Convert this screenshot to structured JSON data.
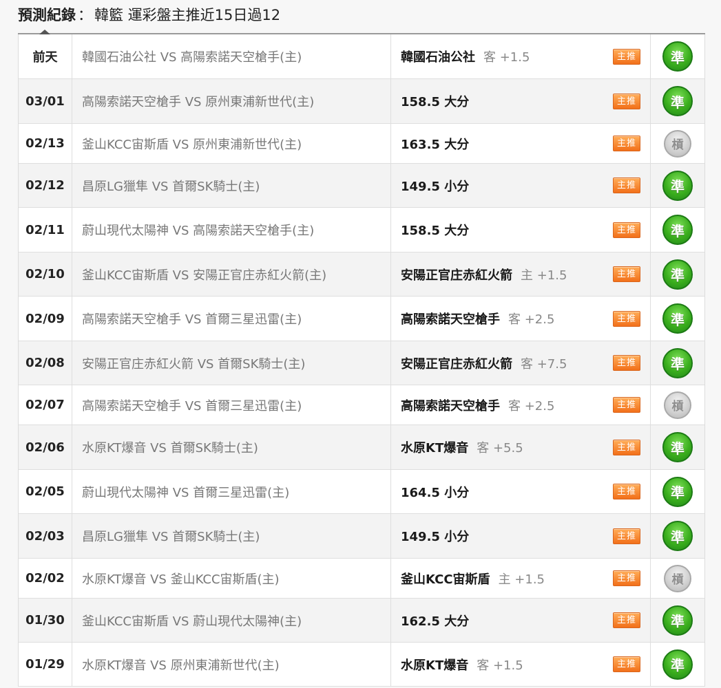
{
  "header": {
    "label": "預測紀錄",
    "separator": "：",
    "summary": "韓籃 運彩盤主推近15日過12"
  },
  "badge_label": "主推",
  "rows": [
    {
      "date": "前天",
      "match": "韓國石油公社 VS 高陽索諾天空槍手(主)",
      "pick": "韓國石油公社",
      "spread": "客 +1.5",
      "result": "準",
      "hit": true
    },
    {
      "date": "03/01",
      "match": "高陽索諾天空槍手 VS 原州東浦新世代(主)",
      "pick": "158.5 大分",
      "spread": "",
      "result": "準",
      "hit": true
    },
    {
      "date": "02/13",
      "match": "釜山KCC宙斯盾 VS 原州東浦新世代(主)",
      "pick": "163.5 大分",
      "spread": "",
      "result": "槓",
      "hit": false
    },
    {
      "date": "02/12",
      "match": "昌原LG獵隼 VS 首爾SK騎士(主)",
      "pick": "149.5 小分",
      "spread": "",
      "result": "準",
      "hit": true
    },
    {
      "date": "02/11",
      "match": "蔚山現代太陽神 VS 高陽索諾天空槍手(主)",
      "pick": "158.5 大分",
      "spread": "",
      "result": "準",
      "hit": true
    },
    {
      "date": "02/10",
      "match": "釜山KCC宙斯盾 VS 安陽正官庄赤紅火箭(主)",
      "pick": "安陽正官庄赤紅火箭",
      "spread": "主 +1.5",
      "result": "準",
      "hit": true
    },
    {
      "date": "02/09",
      "match": "高陽索諾天空槍手 VS 首爾三星迅雷(主)",
      "pick": "高陽索諾天空槍手",
      "spread": "客 +2.5",
      "result": "準",
      "hit": true
    },
    {
      "date": "02/08",
      "match": "安陽正官庄赤紅火箭 VS 首爾SK騎士(主)",
      "pick": "安陽正官庄赤紅火箭",
      "spread": "客 +7.5",
      "result": "準",
      "hit": true
    },
    {
      "date": "02/07",
      "match": "高陽索諾天空槍手 VS 首爾三星迅雷(主)",
      "pick": "高陽索諾天空槍手",
      "spread": "客 +2.5",
      "result": "槓",
      "hit": false
    },
    {
      "date": "02/06",
      "match": "水原KT爆音 VS 首爾SK騎士(主)",
      "pick": "水原KT爆音",
      "spread": "客 +5.5",
      "result": "準",
      "hit": true
    },
    {
      "date": "02/05",
      "match": "蔚山現代太陽神 VS 首爾三星迅雷(主)",
      "pick": "164.5 小分",
      "spread": "",
      "result": "準",
      "hit": true
    },
    {
      "date": "02/03",
      "match": "昌原LG獵隼 VS 首爾SK騎士(主)",
      "pick": "149.5 小分",
      "spread": "",
      "result": "準",
      "hit": true
    },
    {
      "date": "02/02",
      "match": "水原KT爆音 VS 釜山KCC宙斯盾(主)",
      "pick": "釜山KCC宙斯盾",
      "spread": "主 +1.5",
      "result": "槓",
      "hit": false
    },
    {
      "date": "01/30",
      "match": "釜山KCC宙斯盾 VS 蔚山現代太陽神(主)",
      "pick": "162.5 大分",
      "spread": "",
      "result": "準",
      "hit": true
    },
    {
      "date": "01/29",
      "match": "水原KT爆音 VS 原州東浦新世代(主)",
      "pick": "水原KT爆音",
      "spread": "客 +1.5",
      "result": "準",
      "hit": true
    }
  ]
}
